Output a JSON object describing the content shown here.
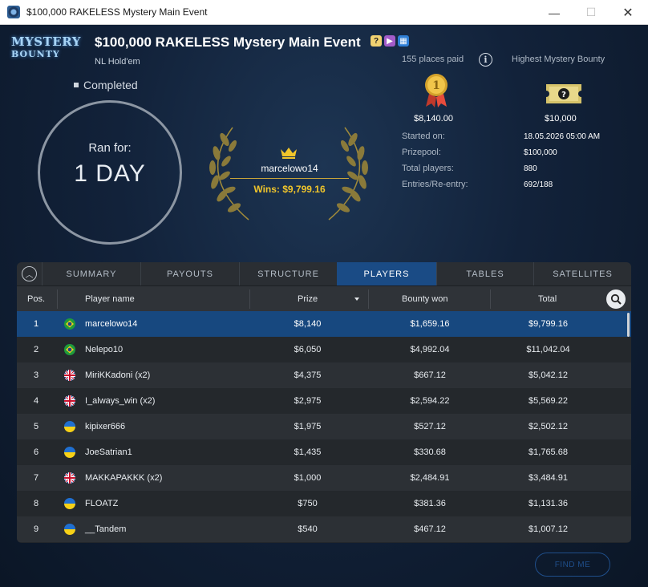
{
  "window": {
    "title": "$100,000 RAKELESS Mystery Main Event",
    "minimize": "—",
    "maximize": "☐",
    "close": "✕"
  },
  "logo": {
    "line1": "MYSTERY",
    "line2": "BOUNTY"
  },
  "event": {
    "title": "$100,000 RAKELESS Mystery Main Event",
    "game_type": "NL Hold'em",
    "status": "Completed",
    "icons": [
      "knockout-icon",
      "video-icon",
      "calendar-icon"
    ]
  },
  "run_for": {
    "label": "Ran for:",
    "value": "1 DAY"
  },
  "winner": {
    "name": "marcelowo14",
    "wins": "Wins: $9,799.16"
  },
  "payout_info": {
    "places_paid": "155 places paid",
    "info_glyph": "i",
    "highest_bounty_label": "Highest Mystery Bounty",
    "first_prize": "$8,140.00",
    "highest_bounty": "$10,000",
    "medal_number": "1"
  },
  "details": [
    {
      "label": "Started on:",
      "value": "18.05.2026   05:00 AM"
    },
    {
      "label": "Prizepool:",
      "value": "$100,000"
    },
    {
      "label": "Total players:",
      "value": "880"
    },
    {
      "label": "Entries/Re-entry:",
      "value": "692/188"
    }
  ],
  "tabs": [
    {
      "label": "SUMMARY",
      "active": false
    },
    {
      "label": "PAYOUTS",
      "active": false
    },
    {
      "label": "STRUCTURE",
      "active": false
    },
    {
      "label": "PLAYERS",
      "active": true
    },
    {
      "label": "TABLES",
      "active": false
    },
    {
      "label": "SATELLITES",
      "active": false
    }
  ],
  "table": {
    "columns": {
      "pos": "Pos.",
      "player": "Player name",
      "prize": "Prize",
      "bounty": "Bounty won",
      "total": "Total"
    },
    "rows": [
      {
        "pos": "1",
        "flag": "brazil",
        "name": "marcelowo14",
        "prize": "$8,140",
        "bounty": "$1,659.16",
        "total": "$9,799.16"
      },
      {
        "pos": "2",
        "flag": "brazil",
        "name": "Nelepo10",
        "prize": "$6,050",
        "bounty": "$4,992.04",
        "total": "$11,042.04"
      },
      {
        "pos": "3",
        "flag": "uk",
        "name": "MiriKKadoni (x2)",
        "prize": "$4,375",
        "bounty": "$667.12",
        "total": "$5,042.12"
      },
      {
        "pos": "4",
        "flag": "uk",
        "name": "I_always_win (x2)",
        "prize": "$2,975",
        "bounty": "$2,594.22",
        "total": "$5,569.22"
      },
      {
        "pos": "5",
        "flag": "ukraine",
        "name": "kipixer666",
        "prize": "$1,975",
        "bounty": "$527.12",
        "total": "$2,502.12"
      },
      {
        "pos": "6",
        "flag": "ukraine",
        "name": "JoeSatrian1",
        "prize": "$1,435",
        "bounty": "$330.68",
        "total": "$1,765.68"
      },
      {
        "pos": "7",
        "flag": "uk",
        "name": "MAKKAPAKKK (x2)",
        "prize": "$1,000",
        "bounty": "$2,484.91",
        "total": "$3,484.91"
      },
      {
        "pos": "8",
        "flag": "ukraine",
        "name": "FLOATZ",
        "prize": "$750",
        "bounty": "$381.36",
        "total": "$1,131.36"
      },
      {
        "pos": "9",
        "flag": "ukraine",
        "name": "__Tandem",
        "prize": "$540",
        "bounty": "$467.12",
        "total": "$1,007.12"
      }
    ]
  },
  "find_me": "FIND ME",
  "colors": {
    "accent": "#1a4b85",
    "gold": "#f0c52b",
    "background": "#12223a"
  }
}
